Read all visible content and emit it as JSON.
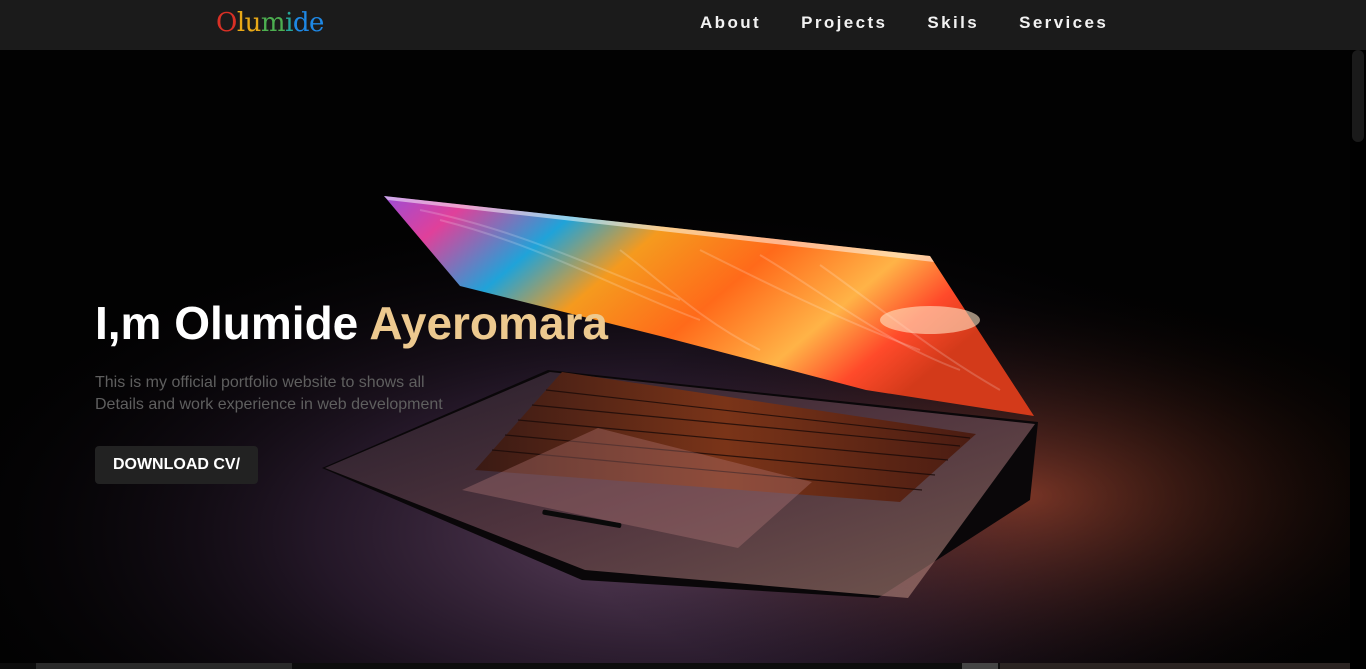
{
  "logo": {
    "letters": [
      "O",
      "l",
      "u",
      "m",
      "i",
      "d",
      "e"
    ],
    "colors": [
      "#d93025",
      "#e8a817",
      "#e8a817",
      "#4caf50",
      "#26a69a",
      "#1e88e5",
      "#1e88e5"
    ]
  },
  "nav": {
    "items": [
      {
        "label": "About"
      },
      {
        "label": "Projects"
      },
      {
        "label": "Skils"
      },
      {
        "label": "Services"
      }
    ]
  },
  "hero": {
    "title_prefix": "I,m Olumide ",
    "title_accent": "Ayeromara",
    "subtitle": "This is my official portfolio website to shows all Details and work experience in web development",
    "cta_label": "DOWNLOAD CV/"
  },
  "colors": {
    "nav_bg": "#1b1b1b",
    "accent": "#edc98f",
    "page_bg": "#000000",
    "button_bg": "#222222"
  }
}
